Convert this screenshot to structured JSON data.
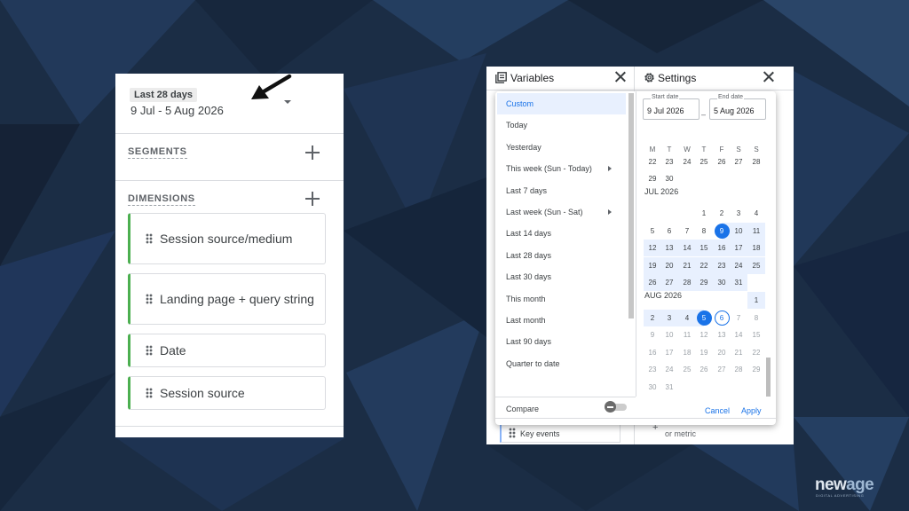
{
  "colors": {
    "accent": "#1a73e8",
    "range_fill": "#e8f0fe",
    "dimension_bar": "#4caf50"
  },
  "left_panel": {
    "range_chip": "Last 28 days",
    "range_dates": "9 Jul - 5 Aug 2026",
    "segments_title": "SEGMENTS",
    "dimensions_title": "DIMENSIONS",
    "dimensions": [
      "Session source/medium",
      "Landing page + query string",
      "Date",
      "Session source"
    ]
  },
  "window": {
    "variables_title": "Variables",
    "settings_title": "Settings",
    "bottom_left_item": "Key events",
    "bottom_right_item": "or metric"
  },
  "date_picker": {
    "presets": [
      "Custom",
      "Today",
      "Yesterday",
      "This week (Sun - Today)",
      "Last 7 days",
      "Last week (Sun - Sat)",
      "Last 14 days",
      "Last 28 days",
      "Last 30 days",
      "This month",
      "Last month",
      "Last 90 days",
      "Quarter to date"
    ],
    "selected_preset": "Custom",
    "presets_with_submenu": [
      "This week (Sun - Today)",
      "Last week (Sun - Sat)"
    ],
    "compare_label": "Compare",
    "compare_on": false,
    "start_label": "Start date",
    "start_value": "9 Jul 2026",
    "end_label": "End date",
    "end_value": "5 Aug 2026",
    "dash": "–",
    "weekdays": [
      "M",
      "T",
      "W",
      "T",
      "F",
      "S",
      "S"
    ],
    "june_tail": {
      "row1": [
        "22",
        "23",
        "24",
        "25",
        "26",
        "27",
        "28"
      ],
      "row2": [
        "29",
        "30"
      ]
    },
    "months": [
      {
        "label": "JUL 2026",
        "first_weekday": 3,
        "days": 31
      },
      {
        "label": "AUG 2026",
        "first_weekday": 6,
        "days": 31
      }
    ],
    "range_start": {
      "month": 0,
      "day": 9
    },
    "range_end": {
      "month": 1,
      "day": 5
    },
    "today": {
      "month": 1,
      "day": 6
    },
    "cancel_label": "Cancel",
    "apply_label": "Apply"
  },
  "logo": {
    "part1": "new",
    "part2": "age",
    "tagline": "DIGITAL ADVERTISING"
  }
}
